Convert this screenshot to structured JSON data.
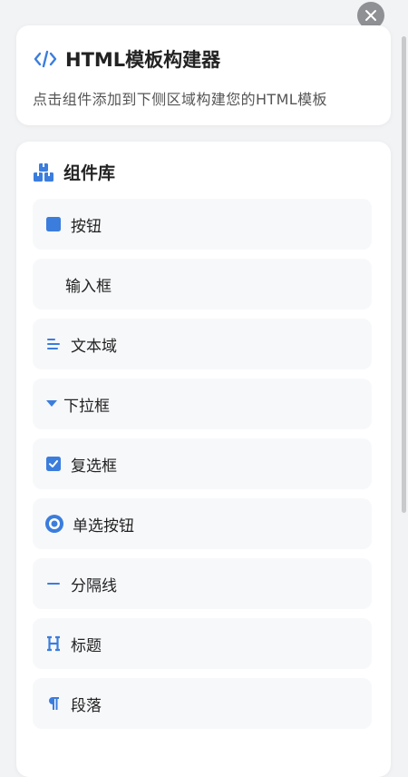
{
  "header": {
    "title": "HTML模板构建器",
    "subtitle": "点击组件添加到下侧区域构建您的HTML模板"
  },
  "library": {
    "title": "组件库",
    "items": [
      {
        "label": "按钮",
        "icon": "square-icon"
      },
      {
        "label": "输入框",
        "icon": "input-icon"
      },
      {
        "label": "文本域",
        "icon": "align-left-icon"
      },
      {
        "label": "下拉框",
        "icon": "caret-down-icon"
      },
      {
        "label": "复选框",
        "icon": "checkbox-icon"
      },
      {
        "label": "单选按钮",
        "icon": "radio-icon"
      },
      {
        "label": "分隔线",
        "icon": "divider-icon"
      },
      {
        "label": "标题",
        "icon": "heading-icon"
      },
      {
        "label": "段落",
        "icon": "paragraph-icon"
      }
    ]
  },
  "colors": {
    "accent": "#3b7ddd",
    "close_button": "#8e9094",
    "card": "#ffffff",
    "item_bg": "#f7f8fa",
    "page_bg": "#f2f3f5"
  }
}
